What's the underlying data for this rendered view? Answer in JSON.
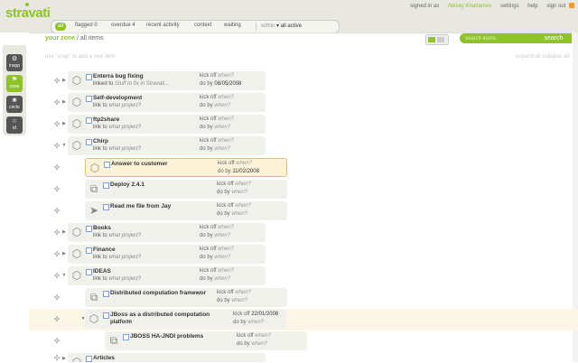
{
  "app": {
    "logo": "stravati"
  },
  "userbar": {
    "signed_in_as": "signed in as",
    "username": "Alexey Kharlamov",
    "settings": "settings",
    "help": "help",
    "sign_out": "sign out"
  },
  "tabs": {
    "all": "all",
    "flagged": "flagged 0",
    "overdue": "overdue 4",
    "recent": "recent activity",
    "context": "context",
    "waiting": "waiting",
    "within": "within",
    "within_value": "▾ all active"
  },
  "sidebar": [
    {
      "label": "inspp",
      "icon": "⚙"
    },
    {
      "label": "zone",
      "icon": "⚑"
    },
    {
      "label": "circle",
      "icon": "❀"
    },
    {
      "label": "id",
      "icon": "☆"
    }
  ],
  "breadcrumb": {
    "zone": "your zone",
    "sep": " / ",
    "current": "all items"
  },
  "search": {
    "placeholder": "search items",
    "button": "search"
  },
  "hint": "use \"snap\" to add a new item",
  "expand": {
    "expand_all": "expand all",
    "collapse_all": "collapse all"
  },
  "tasks": [
    {
      "title": "Enterra bug fixing",
      "sub_prefix": "linked to",
      "sub_link": "Stuff to fix in Stravati...",
      "kick": "kick off",
      "kick_q": "when?",
      "do_by": "do by",
      "do_val": "08/05/2008",
      "icon": "⬡"
    },
    {
      "title": "Self-development",
      "sub_prefix": "link to",
      "sub_link": "what project?",
      "kick": "kick off",
      "kick_q": "when?",
      "do_by": "do by",
      "do_val": "when?",
      "icon": "⬡"
    },
    {
      "title": "ftp2share",
      "sub_prefix": "link to",
      "sub_link": "what project?",
      "kick": "kick off",
      "kick_q": "when?",
      "do_by": "do by",
      "do_val": "when?",
      "icon": "⬡"
    },
    {
      "title": "Chirp",
      "sub_prefix": "link to",
      "sub_link": "what project?",
      "kick": "kick off",
      "kick_q": "when?",
      "do_by": "do by",
      "do_val": "when?",
      "icon": "⬡"
    },
    {
      "title": "Answer to customer",
      "sub_prefix": "",
      "sub_link": "",
      "kick": "kick off",
      "kick_q": "when?",
      "do_by": "do by",
      "do_val": "11/02/2008",
      "icon": "⬡"
    },
    {
      "title": "Deploy 2.4.1",
      "sub_prefix": "",
      "sub_link": "",
      "kick": "kick off",
      "kick_q": "when?",
      "do_by": "do by",
      "do_val": "when?",
      "icon": "⧉"
    },
    {
      "title": "Read me file from Jay",
      "sub_prefix": "",
      "sub_link": "",
      "kick": "kick off",
      "kick_q": "when?",
      "do_by": "do by",
      "do_val": "when?",
      "icon": "➤"
    },
    {
      "title": "Books",
      "sub_prefix": "link to",
      "sub_link": "what project?",
      "kick": "kick off",
      "kick_q": "when?",
      "do_by": "do by",
      "do_val": "when?",
      "icon": "⬡"
    },
    {
      "title": "Finance",
      "sub_prefix": "link to",
      "sub_link": "what project?",
      "kick": "kick off",
      "kick_q": "when?",
      "do_by": "do by",
      "do_val": "when?",
      "icon": "⬡"
    },
    {
      "title": "IDEAS",
      "sub_prefix": "link to",
      "sub_link": "what project?",
      "kick": "kick off",
      "kick_q": "when?",
      "do_by": "do by",
      "do_val": "when?",
      "icon": "⬡"
    },
    {
      "title": "Distributed computation framewor",
      "sub_prefix": "",
      "sub_link": "",
      "kick": "kick off",
      "kick_q": "when?",
      "do_by": "do by",
      "do_val": "when?",
      "icon": "⧉"
    },
    {
      "title": "JBoss as a distributed computation",
      "title2": "platform",
      "sub_prefix": "",
      "sub_link": "",
      "kick": "kick off",
      "kick_q": "22/01/2008",
      "do_by": "do by",
      "do_val": "when?",
      "icon": "⬡"
    },
    {
      "title": "JBOSS HA-JNDI problems",
      "sub_prefix": "",
      "sub_link": "",
      "kick": "kick off",
      "kick_q": "when?",
      "do_by": "do by",
      "do_val": "when?",
      "icon": "⧉"
    },
    {
      "title": "Articles",
      "sub_prefix": "",
      "sub_link": "",
      "kick": "",
      "kick_q": "",
      "do_by": "",
      "do_val": "",
      "icon": "⬡"
    }
  ]
}
